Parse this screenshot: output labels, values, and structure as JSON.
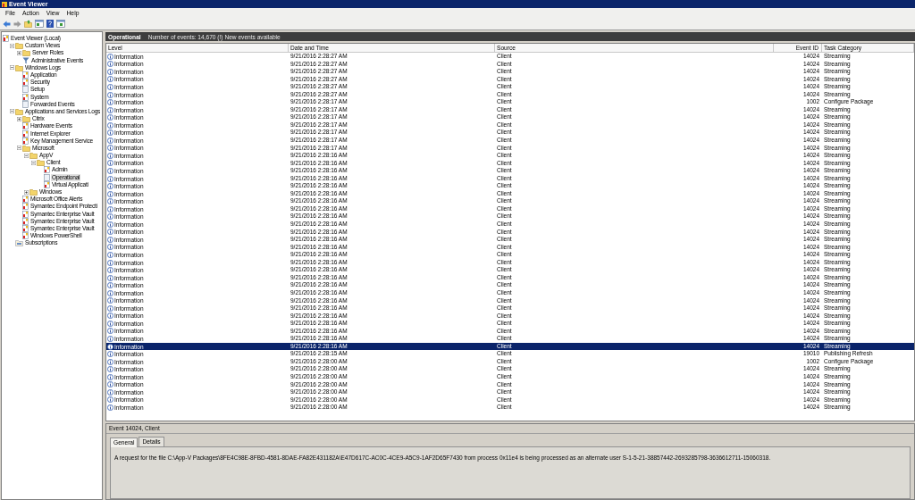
{
  "window": {
    "title": "Event Viewer"
  },
  "menu": [
    "File",
    "Action",
    "View",
    "Help"
  ],
  "tree": [
    {
      "label": "Event Viewer (Local)",
      "kind": "root",
      "selected": false,
      "children": [
        {
          "label": "Custom Views",
          "kind": "folder",
          "expanded": true,
          "selected": false,
          "children": [
            {
              "label": "Server Roles",
              "kind": "folder",
              "expanded": false,
              "selected": false
            },
            {
              "label": "Administrative Events",
              "kind": "filter",
              "selected": false
            }
          ]
        },
        {
          "label": "Windows Logs",
          "kind": "folder",
          "expanded": true,
          "selected": false,
          "children": [
            {
              "label": "Application",
              "kind": "log",
              "selected": false
            },
            {
              "label": "Security",
              "kind": "log",
              "selected": false
            },
            {
              "label": "Setup",
              "kind": "log_empty",
              "selected": false
            },
            {
              "label": "System",
              "kind": "log",
              "selected": false
            },
            {
              "label": "Forwarded Events",
              "kind": "log_empty",
              "selected": false
            }
          ]
        },
        {
          "label": "Applications and Services Logs",
          "kind": "folder",
          "expanded": true,
          "selected": false,
          "children": [
            {
              "label": "Citrix",
              "kind": "folder",
              "expanded": false,
              "selected": false
            },
            {
              "label": "Hardware Events",
              "kind": "log",
              "selected": false
            },
            {
              "label": "Internet Explorer",
              "kind": "log",
              "selected": false
            },
            {
              "label": "Key Management Service",
              "kind": "log",
              "selected": false
            },
            {
              "label": "Microsoft",
              "kind": "folder",
              "expanded": true,
              "selected": false,
              "children": [
                {
                  "label": "AppV",
                  "kind": "folder",
                  "expanded": true,
                  "selected": false,
                  "children": [
                    {
                      "label": "Client",
                      "kind": "folder",
                      "expanded": true,
                      "selected": false,
                      "children": [
                        {
                          "label": "Admin",
                          "kind": "log",
                          "selected": false
                        },
                        {
                          "label": "Operational",
                          "kind": "log_empty",
                          "selected": true
                        },
                        {
                          "label": "Virtual Applicati",
                          "kind": "log",
                          "selected": false
                        }
                      ]
                    }
                  ]
                },
                {
                  "label": "Windows",
                  "kind": "folder",
                  "expanded": false,
                  "selected": false
                }
              ]
            },
            {
              "label": "Microsoft Office Alerts",
              "kind": "log",
              "selected": false
            },
            {
              "label": "Symantec Endpoint Protecti",
              "kind": "log",
              "selected": false
            },
            {
              "label": "Symantec Enterprise Vault",
              "kind": "log",
              "selected": false
            },
            {
              "label": "Symantec Enterprise Vault",
              "kind": "log",
              "selected": false
            },
            {
              "label": "Symantec Enterprise Vault",
              "kind": "log",
              "selected": false
            },
            {
              "label": "Windows PowerShell",
              "kind": "log",
              "selected": false
            }
          ]
        },
        {
          "label": "Subscriptions",
          "kind": "subscriptions",
          "selected": false
        }
      ]
    }
  ],
  "log_header": {
    "title": "Operational",
    "summary": "Number of events: 14,670 (!) New events available"
  },
  "table": {
    "columns": [
      "Level",
      "Date and Time",
      "Source",
      "Event ID",
      "Task Category"
    ],
    "rows": [
      {
        "level": "Information",
        "date_time": "9/21/2016 2:28:27 AM",
        "source": "Client",
        "event_id": "14024",
        "task_category": "Streaming",
        "selected": false
      },
      {
        "level": "Information",
        "date_time": "9/21/2016 2:28:27 AM",
        "source": "Client",
        "event_id": "14024",
        "task_category": "Streaming",
        "selected": false
      },
      {
        "level": "Information",
        "date_time": "9/21/2016 2:28:27 AM",
        "source": "Client",
        "event_id": "14024",
        "task_category": "Streaming",
        "selected": false
      },
      {
        "level": "Information",
        "date_time": "9/21/2016 2:28:27 AM",
        "source": "Client",
        "event_id": "14024",
        "task_category": "Streaming",
        "selected": false
      },
      {
        "level": "Information",
        "date_time": "9/21/2016 2:28:27 AM",
        "source": "Client",
        "event_id": "14024",
        "task_category": "Streaming",
        "selected": false
      },
      {
        "level": "Information",
        "date_time": "9/21/2016 2:28:27 AM",
        "source": "Client",
        "event_id": "14024",
        "task_category": "Streaming",
        "selected": false
      },
      {
        "level": "Information",
        "date_time": "9/21/2016 2:28:17 AM",
        "source": "Client",
        "event_id": "1002",
        "task_category": "Configure Package",
        "selected": false
      },
      {
        "level": "Information",
        "date_time": "9/21/2016 2:28:17 AM",
        "source": "Client",
        "event_id": "14024",
        "task_category": "Streaming",
        "selected": false
      },
      {
        "level": "Information",
        "date_time": "9/21/2016 2:28:17 AM",
        "source": "Client",
        "event_id": "14024",
        "task_category": "Streaming",
        "selected": false
      },
      {
        "level": "Information",
        "date_time": "9/21/2016 2:28:17 AM",
        "source": "Client",
        "event_id": "14024",
        "task_category": "Streaming",
        "selected": false
      },
      {
        "level": "Information",
        "date_time": "9/21/2016 2:28:17 AM",
        "source": "Client",
        "event_id": "14024",
        "task_category": "Streaming",
        "selected": false
      },
      {
        "level": "Information",
        "date_time": "9/21/2016 2:28:17 AM",
        "source": "Client",
        "event_id": "14024",
        "task_category": "Streaming",
        "selected": false
      },
      {
        "level": "Information",
        "date_time": "9/21/2016 2:28:17 AM",
        "source": "Client",
        "event_id": "14024",
        "task_category": "Streaming",
        "selected": false
      },
      {
        "level": "Information",
        "date_time": "9/21/2016 2:28:16 AM",
        "source": "Client",
        "event_id": "14024",
        "task_category": "Streaming",
        "selected": false
      },
      {
        "level": "Information",
        "date_time": "9/21/2016 2:28:16 AM",
        "source": "Client",
        "event_id": "14024",
        "task_category": "Streaming",
        "selected": false
      },
      {
        "level": "Information",
        "date_time": "9/21/2016 2:28:16 AM",
        "source": "Client",
        "event_id": "14024",
        "task_category": "Streaming",
        "selected": false
      },
      {
        "level": "Information",
        "date_time": "9/21/2016 2:28:16 AM",
        "source": "Client",
        "event_id": "14024",
        "task_category": "Streaming",
        "selected": false
      },
      {
        "level": "Information",
        "date_time": "9/21/2016 2:28:16 AM",
        "source": "Client",
        "event_id": "14024",
        "task_category": "Streaming",
        "selected": false
      },
      {
        "level": "Information",
        "date_time": "9/21/2016 2:28:16 AM",
        "source": "Client",
        "event_id": "14024",
        "task_category": "Streaming",
        "selected": false
      },
      {
        "level": "Information",
        "date_time": "9/21/2016 2:28:16 AM",
        "source": "Client",
        "event_id": "14024",
        "task_category": "Streaming",
        "selected": false
      },
      {
        "level": "Information",
        "date_time": "9/21/2016 2:28:16 AM",
        "source": "Client",
        "event_id": "14024",
        "task_category": "Streaming",
        "selected": false
      },
      {
        "level": "Information",
        "date_time": "9/21/2016 2:28:16 AM",
        "source": "Client",
        "event_id": "14024",
        "task_category": "Streaming",
        "selected": false
      },
      {
        "level": "Information",
        "date_time": "9/21/2016 2:28:16 AM",
        "source": "Client",
        "event_id": "14024",
        "task_category": "Streaming",
        "selected": false
      },
      {
        "level": "Information",
        "date_time": "9/21/2016 2:28:16 AM",
        "source": "Client",
        "event_id": "14024",
        "task_category": "Streaming",
        "selected": false
      },
      {
        "level": "Information",
        "date_time": "9/21/2016 2:28:16 AM",
        "source": "Client",
        "event_id": "14024",
        "task_category": "Streaming",
        "selected": false
      },
      {
        "level": "Information",
        "date_time": "9/21/2016 2:28:16 AM",
        "source": "Client",
        "event_id": "14024",
        "task_category": "Streaming",
        "selected": false
      },
      {
        "level": "Information",
        "date_time": "9/21/2016 2:28:16 AM",
        "source": "Client",
        "event_id": "14024",
        "task_category": "Streaming",
        "selected": false
      },
      {
        "level": "Information",
        "date_time": "9/21/2016 2:28:16 AM",
        "source": "Client",
        "event_id": "14024",
        "task_category": "Streaming",
        "selected": false
      },
      {
        "level": "Information",
        "date_time": "9/21/2016 2:28:16 AM",
        "source": "Client",
        "event_id": "14024",
        "task_category": "Streaming",
        "selected": false
      },
      {
        "level": "Information",
        "date_time": "9/21/2016 2:28:16 AM",
        "source": "Client",
        "event_id": "14024",
        "task_category": "Streaming",
        "selected": false
      },
      {
        "level": "Information",
        "date_time": "9/21/2016 2:28:16 AM",
        "source": "Client",
        "event_id": "14024",
        "task_category": "Streaming",
        "selected": false
      },
      {
        "level": "Information",
        "date_time": "9/21/2016 2:28:16 AM",
        "source": "Client",
        "event_id": "14024",
        "task_category": "Streaming",
        "selected": false
      },
      {
        "level": "Information",
        "date_time": "9/21/2016 2:28:16 AM",
        "source": "Client",
        "event_id": "14024",
        "task_category": "Streaming",
        "selected": false
      },
      {
        "level": "Information",
        "date_time": "9/21/2016 2:28:16 AM",
        "source": "Client",
        "event_id": "14024",
        "task_category": "Streaming",
        "selected": false
      },
      {
        "level": "Information",
        "date_time": "9/21/2016 2:28:16 AM",
        "source": "Client",
        "event_id": "14024",
        "task_category": "Streaming",
        "selected": false
      },
      {
        "level": "Information",
        "date_time": "9/21/2016 2:28:16 AM",
        "source": "Client",
        "event_id": "14024",
        "task_category": "Streaming",
        "selected": false
      },
      {
        "level": "Information",
        "date_time": "9/21/2016 2:28:16 AM",
        "source": "Client",
        "event_id": "14024",
        "task_category": "Streaming",
        "selected": false
      },
      {
        "level": "Information",
        "date_time": "9/21/2016 2:28:16 AM",
        "source": "Client",
        "event_id": "14024",
        "task_category": "Streaming",
        "selected": false
      },
      {
        "level": "Information",
        "date_time": "9/21/2016 2:28:16 AM",
        "source": "Client",
        "event_id": "14024",
        "task_category": "Streaming",
        "selected": true
      },
      {
        "level": "Information",
        "date_time": "9/21/2016 2:28:15 AM",
        "source": "Client",
        "event_id": "19010",
        "task_category": "Publishing Refresh",
        "selected": false
      },
      {
        "level": "Information",
        "date_time": "9/21/2016 2:28:00 AM",
        "source": "Client",
        "event_id": "1002",
        "task_category": "Configure Package",
        "selected": false
      },
      {
        "level": "Information",
        "date_time": "9/21/2016 2:28:00 AM",
        "source": "Client",
        "event_id": "14024",
        "task_category": "Streaming",
        "selected": false
      },
      {
        "level": "Information",
        "date_time": "9/21/2016 2:28:00 AM",
        "source": "Client",
        "event_id": "14024",
        "task_category": "Streaming",
        "selected": false
      },
      {
        "level": "Information",
        "date_time": "9/21/2016 2:28:00 AM",
        "source": "Client",
        "event_id": "14024",
        "task_category": "Streaming",
        "selected": false
      },
      {
        "level": "Information",
        "date_time": "9/21/2016 2:28:00 AM",
        "source": "Client",
        "event_id": "14024",
        "task_category": "Streaming",
        "selected": false
      },
      {
        "level": "Information",
        "date_time": "9/21/2016 2:28:00 AM",
        "source": "Client",
        "event_id": "14024",
        "task_category": "Streaming",
        "selected": false
      },
      {
        "level": "Information",
        "date_time": "9/21/2016 2:28:00 AM",
        "source": "Client",
        "event_id": "14024",
        "task_category": "Streaming",
        "selected": false
      }
    ]
  },
  "details": {
    "title": "Event 14024, Client",
    "tabs": [
      {
        "label": "General",
        "selected": true
      },
      {
        "label": "Details",
        "selected": false
      }
    ],
    "message": "A request for the file C:\\App-V Packages\\8FE4C98E-8FBD-4581-8DAE-FA82E431182A\\E47D617C-AC0C-4CE9-A5C9-1AF2D65F7430 from process 0x11e4 is being processed as an alternate user S-1-5-21-38857442-2693285798-3636612711-15060318."
  }
}
